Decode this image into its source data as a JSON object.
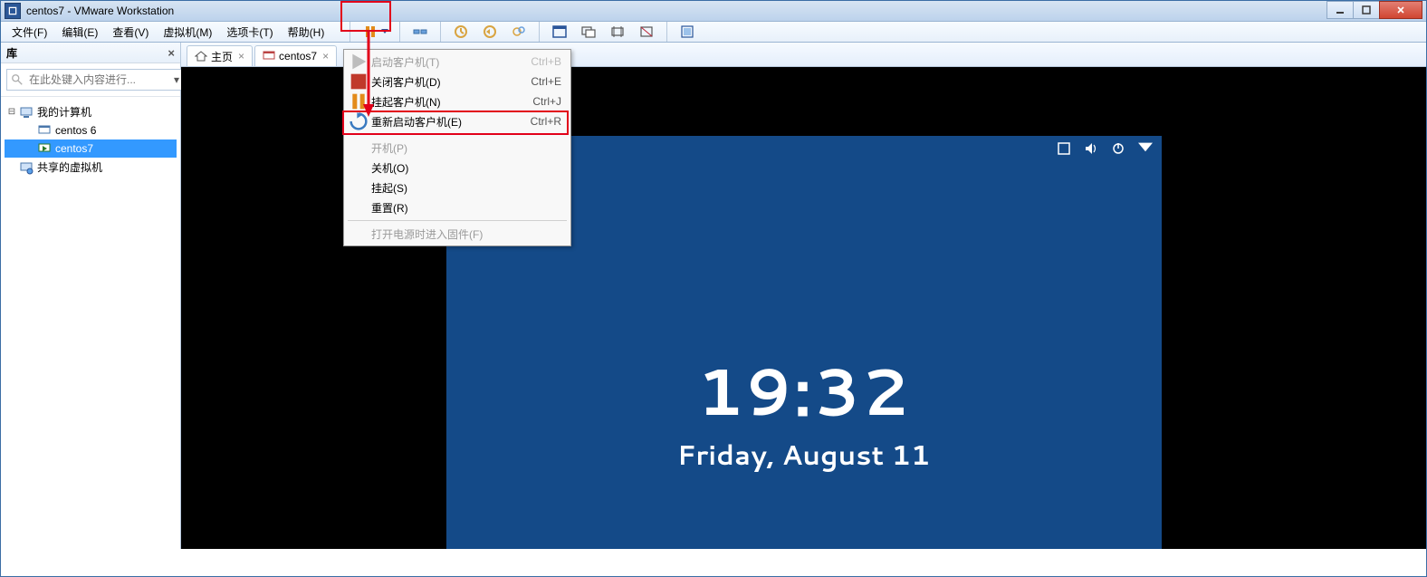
{
  "title": "centos7 - VMware Workstation",
  "menubar": {
    "file": "文件(F)",
    "edit": "编辑(E)",
    "view": "查看(V)",
    "vm": "虚拟机(M)",
    "tabs": "选项卡(T)",
    "help": "帮助(H)"
  },
  "sidebar": {
    "header": "库",
    "search_placeholder": "在此处键入内容进行...",
    "my_computer": "我的计算机",
    "vm_centos6": "centos 6",
    "vm_centos7": "centos7",
    "shared_vms": "共享的虚拟机"
  },
  "tabs": {
    "home": "主页",
    "centos7": "centos7"
  },
  "dropdown": {
    "start_guest": {
      "label": "启动客户机(T)",
      "shortcut": "Ctrl+B"
    },
    "shutdown_guest": {
      "label": "关闭客户机(D)",
      "shortcut": "Ctrl+E"
    },
    "suspend_guest": {
      "label": "挂起客户机(N)",
      "shortcut": "Ctrl+J"
    },
    "restart_guest": {
      "label": "重新启动客户机(E)",
      "shortcut": "Ctrl+R"
    },
    "power_on": "开机(P)",
    "power_off": "关机(O)",
    "suspend": "挂起(S)",
    "reset": "重置(R)",
    "power_on_firmware": "打开电源时进入固件(F)"
  },
  "guest": {
    "time": "19:32",
    "date": "Friday, August 11"
  },
  "icons": {
    "power": "power-icon",
    "snapshot": "snapshot-icon",
    "fullscreen": "fullscreen-icon"
  }
}
